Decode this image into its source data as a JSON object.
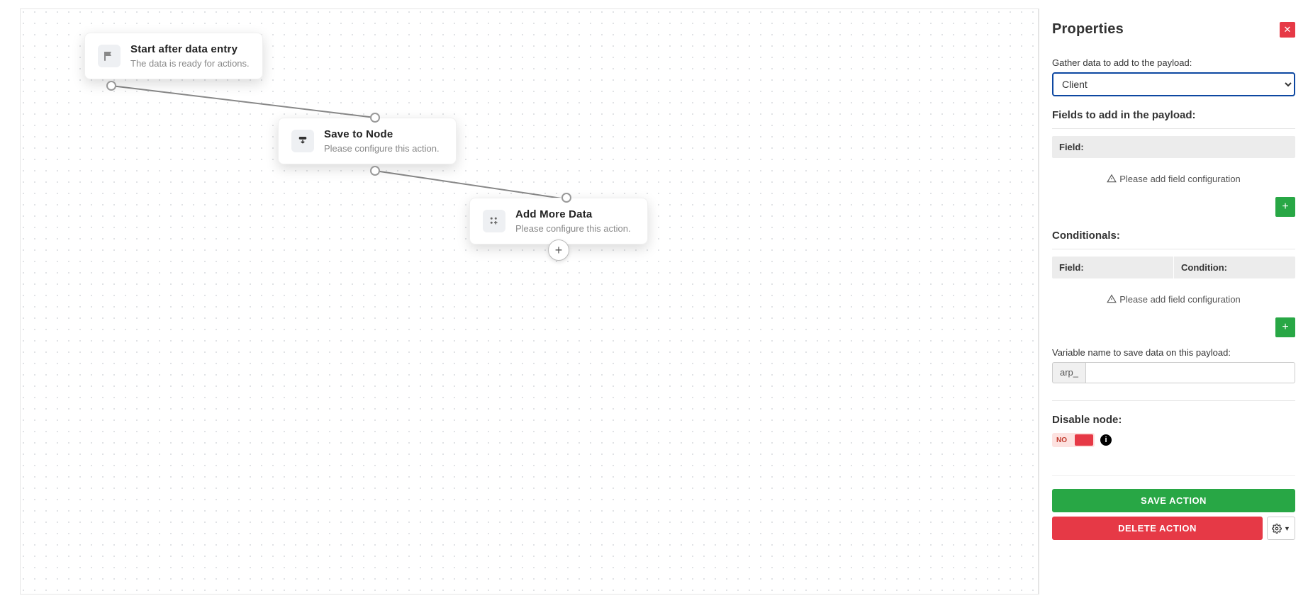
{
  "canvas": {
    "nodes": [
      {
        "id": "n1",
        "title": "Start after data entry",
        "subtitle": "The data is ready for actions.",
        "icon": "flag"
      },
      {
        "id": "n2",
        "title": "Save to Node",
        "subtitle": "Please configure this action.",
        "icon": "download"
      },
      {
        "id": "n3",
        "title": "Add More Data",
        "subtitle": "Please configure this action.",
        "icon": "grid-plus"
      }
    ]
  },
  "panel": {
    "title": "Properties",
    "gather_label": "Gather data to add to the payload:",
    "gather_value": "Client",
    "fields_title": "Fields to add in the payload:",
    "fields_header_field": "Field:",
    "empty_msg": "Please add field configuration",
    "conditionals_title": "Conditionals:",
    "cond_header_field": "Field:",
    "cond_header_condition": "Condition:",
    "varname_label": "Variable name to save data on this payload:",
    "varname_prefix": "arp_",
    "varname_value": "",
    "disable_label": "Disable node:",
    "toggle_no": "NO",
    "save_label": "SAVE ACTION",
    "delete_label": "DELETE ACTION"
  }
}
